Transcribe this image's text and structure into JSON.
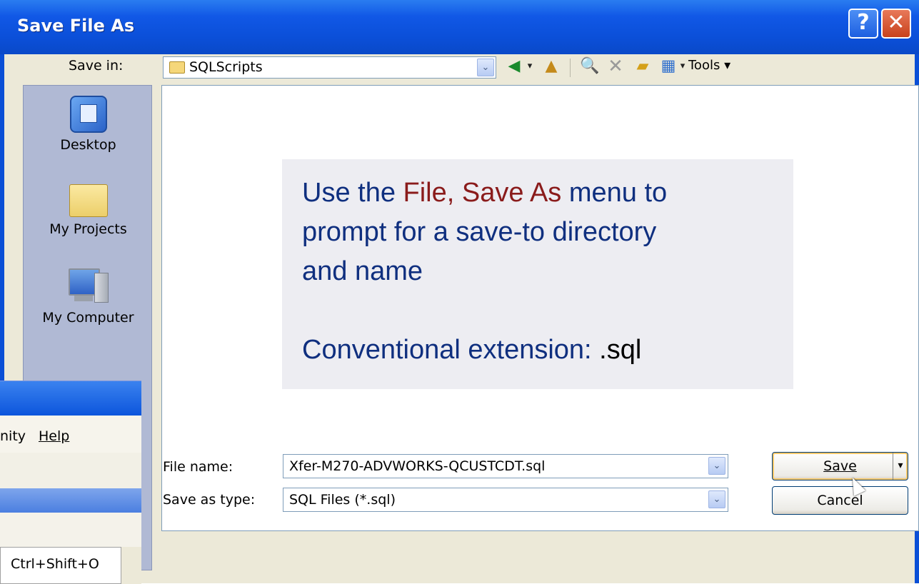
{
  "dialog": {
    "title": "Save File As",
    "help_glyph": "?",
    "close_glyph": "✕"
  },
  "toolbar": {
    "save_in_label": "Save in:",
    "save_in_value": "SQLScripts",
    "combo_arrow": "⌄",
    "back_icon": "◀",
    "up_icon": "▲",
    "search_icon": "🔍",
    "delete_icon": "✕",
    "new_folder_icon": "▰",
    "views_icon": "▦",
    "dropdown_glyph": "▾",
    "tools_label": "Tools ▾"
  },
  "places": [
    {
      "label": "Desktop",
      "icon": "desktop-icon"
    },
    {
      "label": "My Projects",
      "icon": "folder-icon"
    },
    {
      "label": "My Computer",
      "icon": "computer-icon"
    }
  ],
  "callout": {
    "line1_pre": "Use the ",
    "line1_hl": "File, Save As",
    "line1_post": " menu to",
    "line2": "prompt for a save-to directory",
    "line3": "and name",
    "line4_pre": "Conventional extension:  ",
    "line4_ext": ".sql"
  },
  "fields": {
    "file_name_label": "File name:",
    "file_name_value": "Xfer-M270-ADVWORKS-QCUSTCDT.sql",
    "save_as_type_label": "Save as type:",
    "save_as_type_value": "SQL Files (*.sql)"
  },
  "buttons": {
    "save": "Save",
    "save_dropdown": "▾",
    "cancel": "Cancel"
  },
  "background_window": {
    "menu_item_1": "nity",
    "menu_item_2": "Help",
    "shortcut": "Ctrl+Shift+O"
  }
}
